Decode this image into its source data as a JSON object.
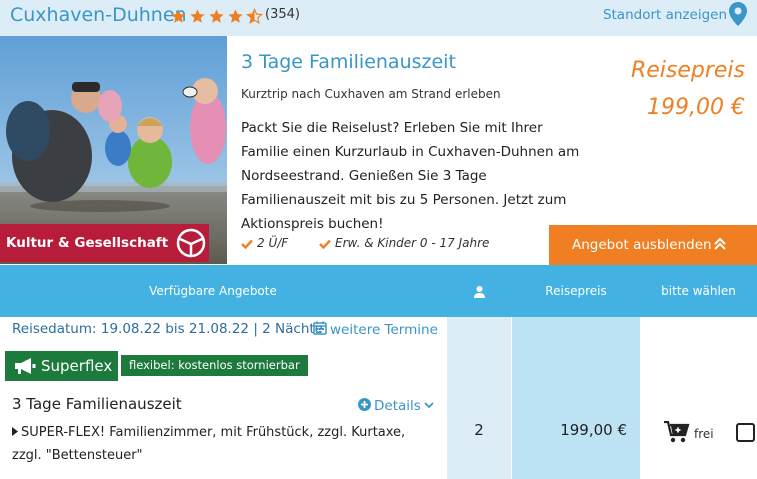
{
  "header": {
    "hotel_name": "Cuxhaven-Duhnen",
    "rating_stars": 4.5,
    "review_count": "(354)",
    "location_link": "Standort anzeigen"
  },
  "offer": {
    "title": "3 Tage Familienauszeit",
    "subtitle": "Kurztrip nach Cuxhaven am Strand erleben",
    "description": "Packt Sie die Reiselust? Erleben Sie mit Ihrer Familie einen Kurzurlaub in Cuxhaven-Duhnen am Nordseestrand. Genießen Sie 3 Tage Familienauszeit mit bis zu 5 Personen. Jetzt zum Aktionspreis buchen!",
    "category": "Kultur & Gesellschaft",
    "price_label": "Reisepreis",
    "price": "199,00 €",
    "features": [
      "2 Ü/F",
      "Erw. & Kinder 0 - 17 Jahre"
    ],
    "hide_button": "Angebot ausblenden"
  },
  "table": {
    "headers": {
      "offers": "Verfügbare Angebote",
      "price": "Reisepreis",
      "choose": "bitte wählen"
    },
    "row": {
      "travel_date": "Reisedatum: 19.08.22 bis 21.08.22 | 2 Nächte",
      "more_dates": "weitere Termine",
      "badge": "Superflex",
      "flex_note": "flexibel: kostenlos stornierbar",
      "room_title": "3 Tage Familienauszeit",
      "details_link": "Details",
      "room_desc": "SUPER-FLEX! Familienzimmer, mit Frühstück, zzgl. Kurtaxe, zzgl. \"Bettensteuer\"",
      "persons": "2",
      "price": "199,00 €",
      "availability": "frei"
    }
  },
  "colors": {
    "brand_blue": "#3a96c7",
    "accent_orange": "#ef7f22",
    "category_red": "#b71c3b",
    "superflex_green": "#1c7a3c",
    "table_header_blue": "#43b2e2"
  }
}
